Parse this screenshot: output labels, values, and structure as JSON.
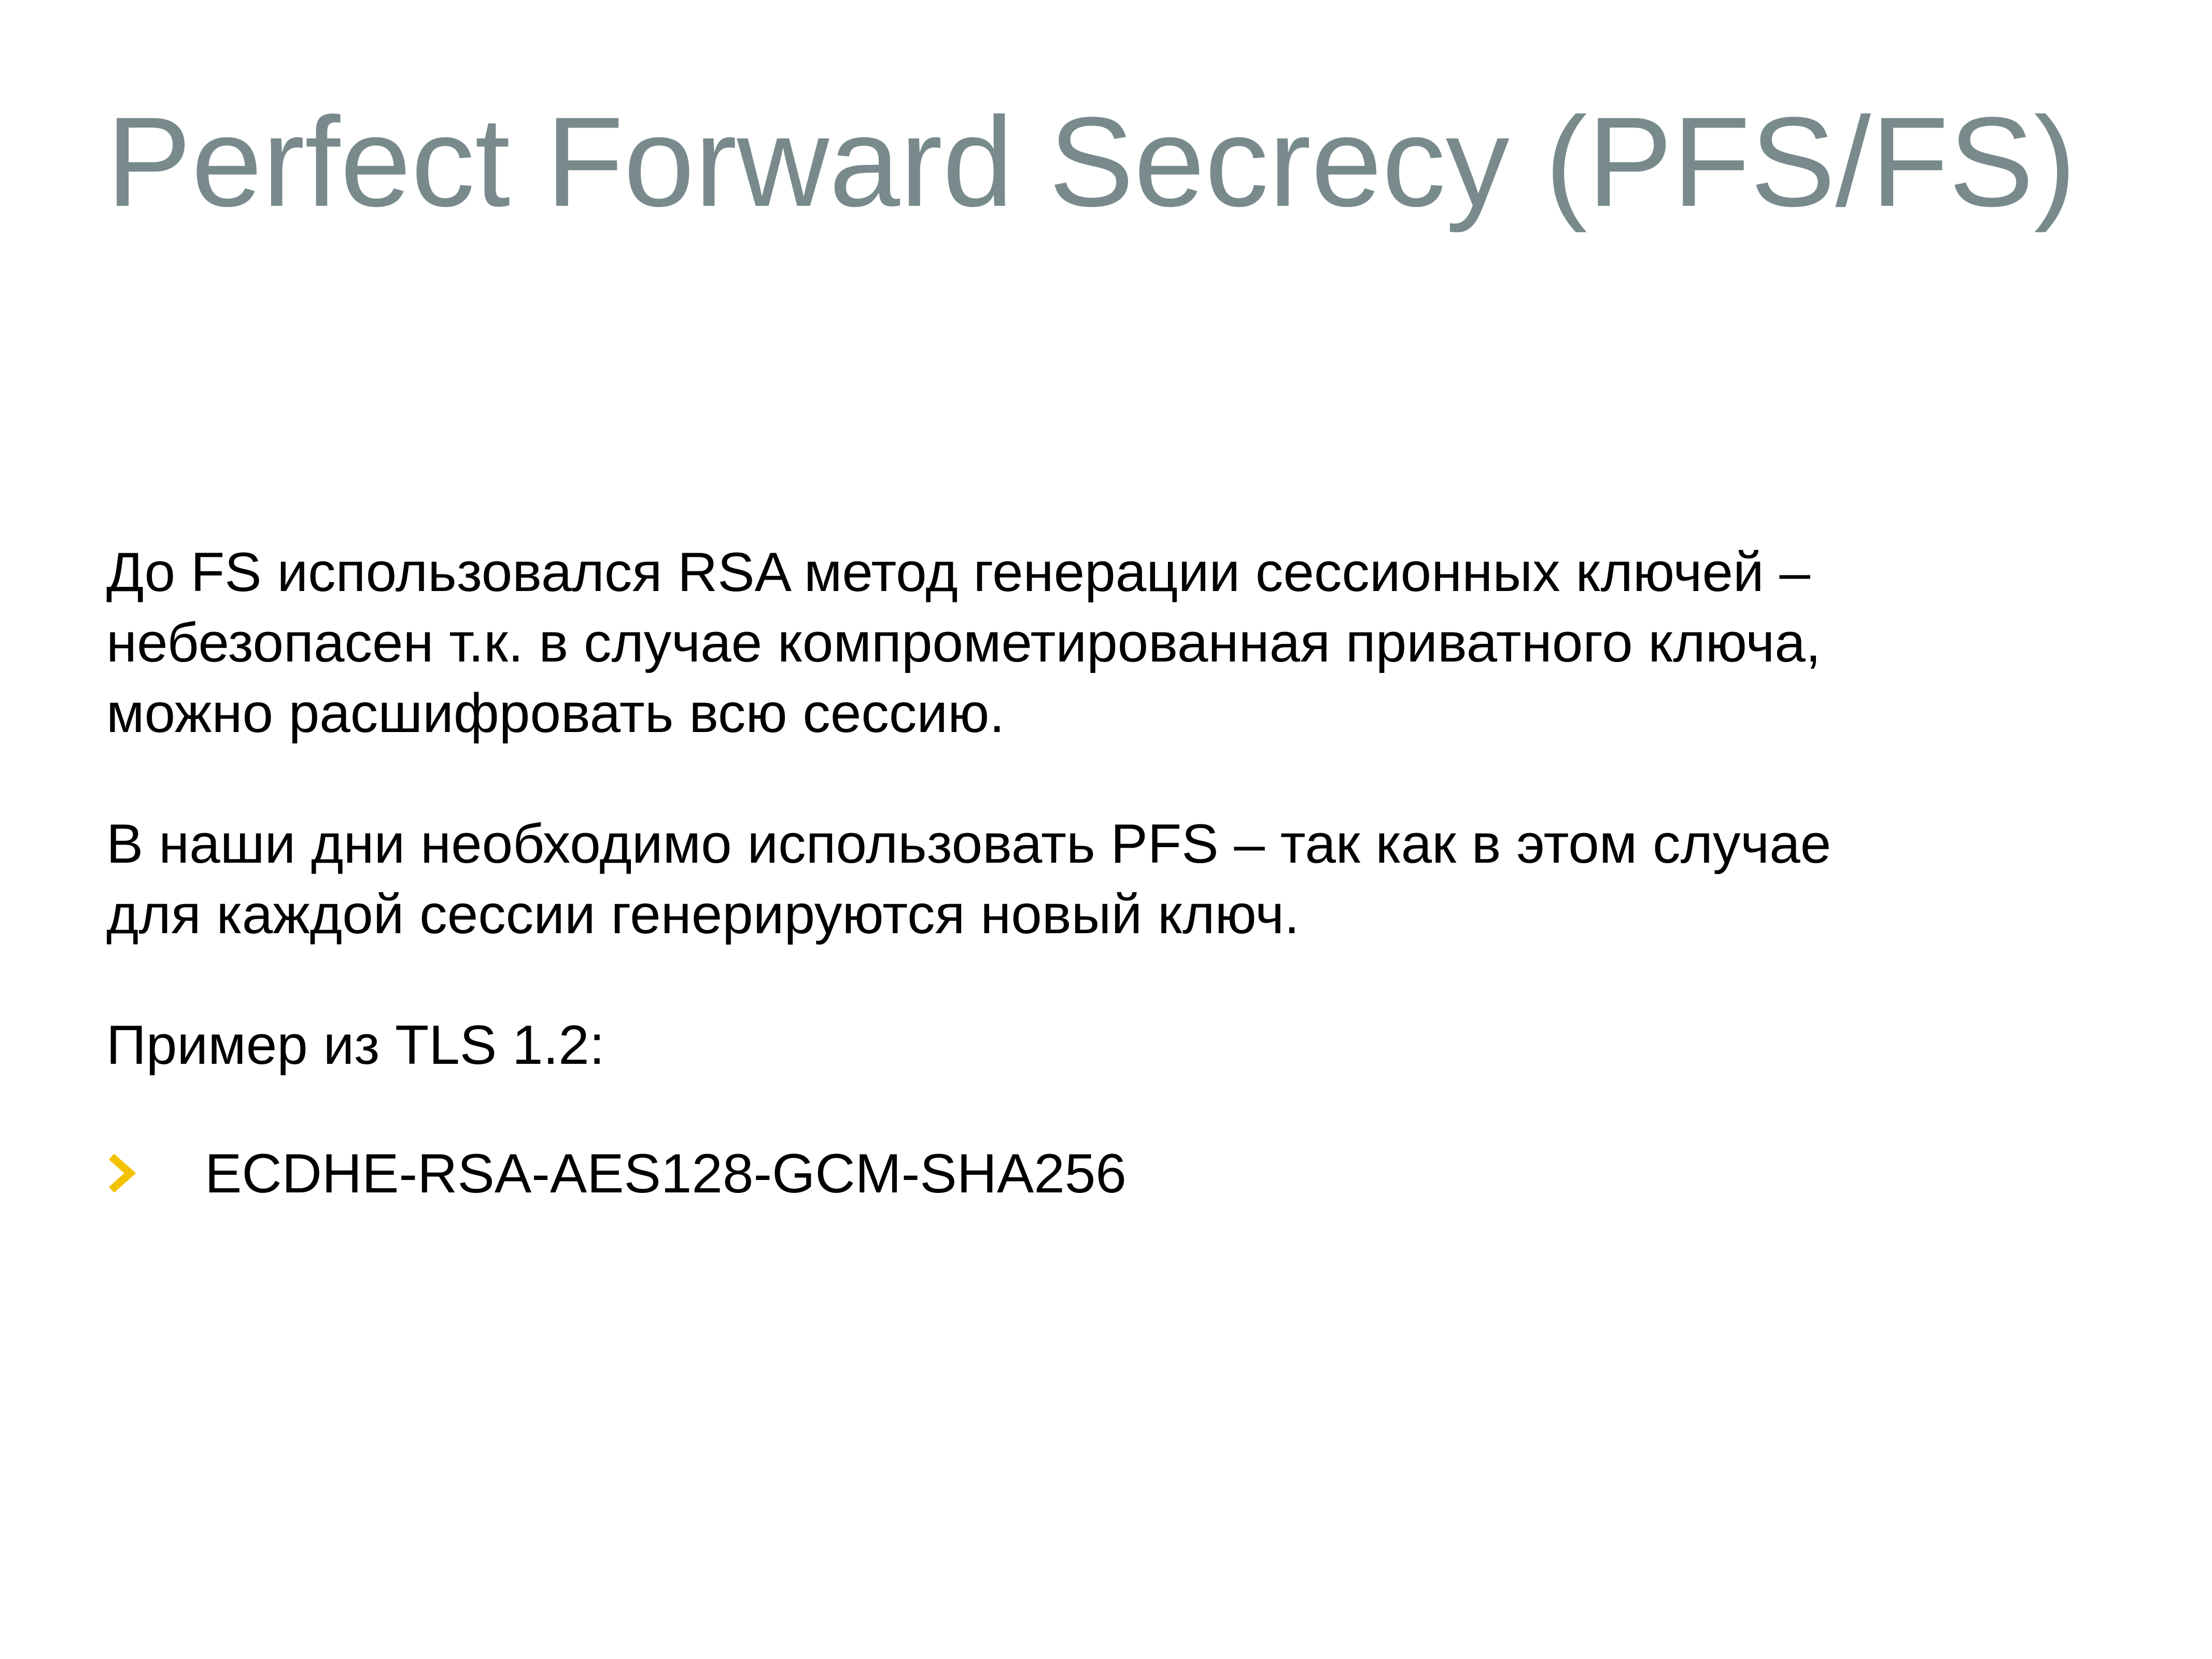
{
  "slide": {
    "title": "Perfect Forward Secrecy (PFS/FS)",
    "paragraphs": [
      {
        "lines": [
          "До FS использовался RSA метод генерации сессионных ключей –",
          "небезопасен т.к. в случае компрометированная приватного ключа,",
          "можно расшифровать всю сессию."
        ]
      },
      {
        "lines": [
          "В наши дни необходимо использовать PFS – так как в этом случае",
          "для каждой сессии генерируются новый ключ."
        ]
      },
      {
        "lines": [
          "Пример из TLS 1.2:"
        ]
      }
    ],
    "bullets": [
      {
        "icon": "chevron-right-icon",
        "text": "ECDHE-RSA-AES128-GCM-SHA256"
      }
    ]
  },
  "colors": {
    "title": "#788A8C",
    "text": "#000000",
    "bullet_accent": "#F2C200",
    "background": "#FFFFFF"
  }
}
